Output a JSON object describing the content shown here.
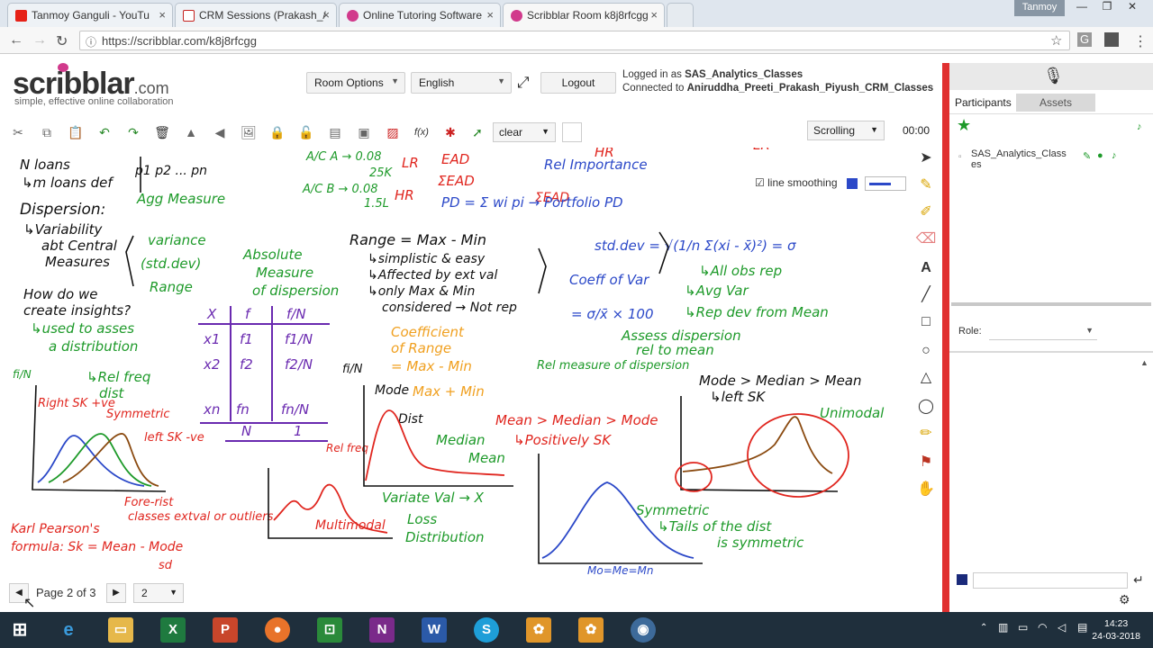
{
  "browser": {
    "tabs": [
      {
        "title": "Tanmoy Ganguli - YouTu",
        "icon_color": "#e62117"
      },
      {
        "title": "CRM Sessions (Prakash_/",
        "icon_color": "#c5221f"
      },
      {
        "title": "Online Tutoring Software",
        "icon_color": "#d13a8c"
      },
      {
        "title": "Scribblar Room k8j8rfcgg",
        "icon_color": "#d13a8c"
      }
    ],
    "profile_name": "Tanmoy",
    "url": "https://scribblar.com/k8j8rfcgg"
  },
  "header": {
    "logo_main": "scribblar",
    "logo_suffix": ".com",
    "tagline": "simple, effective online collaboration",
    "room_options_label": "Room Options",
    "language_label": "English",
    "logout_label": "Logout",
    "logged_in_prefix": "Logged in as ",
    "logged_in_user": "SAS_Analytics_Classes",
    "connected_prefix": "Connected to ",
    "connected_room": "Aniruddha_Preeti_Prakash_Piyush_CRM_Classes"
  },
  "toolbar": {
    "clear_label": "clear",
    "scroll_mode_label": "Scrolling",
    "timer": "00:00",
    "line_smoothing_label": "line smoothing",
    "fx_label": "f(x)"
  },
  "board": {
    "notes": {
      "n1": "N loans",
      "n2": "↳m loans def",
      "n3": "Dispersion:",
      "n4": "↳Variability",
      "n5": "abt Central",
      "n6": "Measures",
      "n7": "variance",
      "n8": "(std.dev)",
      "n9": "Range",
      "n10": "Absolute",
      "n11": "Measure",
      "n12": "of dispersion",
      "n13": "How do we",
      "n14": "create insights?",
      "n15": "↳used to asses",
      "n16": "a distribution",
      "n17": "↳Rel freq",
      "n18": "dist",
      "n19": "Karl Pearson's",
      "n20": "formula: Sk = Mean - Mode",
      "n21": "sd",
      "n22": "Range = Max - Min",
      "n23": "↳simplistic & easy",
      "n24": "↳Affected by ext val",
      "n25": "↳only Max & Min",
      "n26": "considered → Not rep",
      "n27": "Coefficient",
      "n28": "of Range",
      "n29": "= Max - Min",
      "n30": "Max + Min",
      "n31": "Coeff of Var",
      "n32": "= σ/x̄ × 100",
      "n33": "Assess dispersion",
      "n34": "rel to mean",
      "n35": "Rel measure of dispersion",
      "n36": "std.dev = √(1/n Σ(xi - x̄)²) = σ",
      "n37": "↳All obs rep",
      "n38": "↳Avg Var",
      "n39": "↳Rep dev from Mean",
      "n40": "Mode > Median > Mean",
      "n41": "↳left SK",
      "n42": "Unimodal",
      "n43": "Mean > Median > Mode",
      "n44": "↳Positively SK",
      "n45": "Symmetric",
      "n46": "↳Tails of the dist",
      "n47": "is symmetric",
      "n48": "Mo=Me=Mn",
      "n49": "Multimodal",
      "n50": "Variate Val → X",
      "n51": "Loss",
      "n52": "Distribution",
      "n53": "A/C A → 0.08",
      "n54": "25K",
      "n55": "A/C B → 0.08",
      "n56": "1.5L",
      "n57": "LR",
      "n58": "HR",
      "n59": "EAD",
      "n60": "ΣEAD",
      "n61": "Rel Importance",
      "n62": "PD = Σ wi pi → Portfolio PD",
      "n63": "Agg Measure",
      "n64": "p1 p2 ... pn",
      "n65": "Fore-rist",
      "n66": "classes extval or outliers",
      "n67": "Right SK +ve",
      "n68": "Symmetric",
      "n69": "left SK -ve",
      "n70": "Dist",
      "n71": "Median",
      "n72": "Mean",
      "n73": "Mode",
      "n74": "Rel freq",
      "n75": "fi/N"
    },
    "table": {
      "headers": [
        "X",
        "f",
        "f/N"
      ],
      "rows": [
        [
          "x1",
          "f1",
          "f1/N"
        ],
        [
          "x2",
          "f2",
          "f2/N"
        ],
        [
          "xn",
          "fn",
          "fn/N"
        ]
      ],
      "totals": [
        "N",
        "1"
      ]
    }
  },
  "right_panel": {
    "tab_participants": "Participants",
    "tab_assets": "Assets",
    "participant": "SAS_Analytics_Classes",
    "role_label": "Role:"
  },
  "pager": {
    "page_text": "Page 2 of 3",
    "page_select": "2"
  },
  "taskbar": {
    "time": "14:23",
    "date": "24-03-2018"
  },
  "colors": {
    "accent_red": "#e03030",
    "ink_black": "#111111",
    "ink_green": "#1e9a2a",
    "ink_red": "#e0261f",
    "ink_blue": "#2b48c8",
    "ink_purple": "#6a2ab0",
    "ink_orange": "#f0a020",
    "ink_brown": "#8a4a10",
    "taskbar": "#1f2f3c"
  }
}
